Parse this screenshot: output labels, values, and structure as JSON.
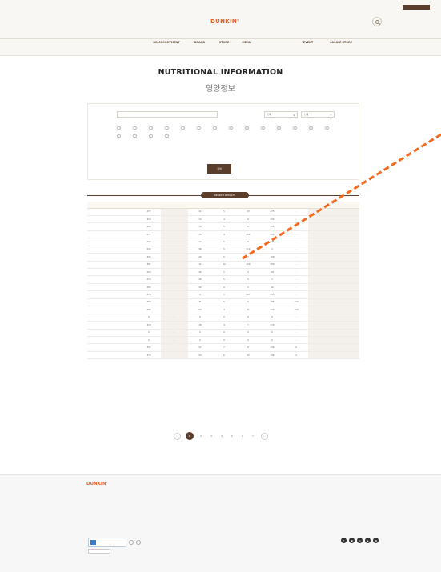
{
  "header": {
    "top_badge": "",
    "brand": "DUNKIN'",
    "left_links": [
      "",
      "",
      "",
      "",
      ""
    ],
    "right_links": [
      "",
      "",
      ""
    ],
    "sub_links": [
      "",
      ""
    ],
    "nav": [
      "DD COMMITMENT",
      "BRAND",
      "STORE",
      "MENU",
      "",
      "EVENT",
      "ONLINE STORE"
    ]
  },
  "page": {
    "title_en": "NUTRITIONAL INFORMATION",
    "title_ko": "영양정보"
  },
  "search": {
    "product_label": "",
    "product_placeholder": "",
    "category_label": "",
    "select1": "전체",
    "select2": "전체",
    "allergy_label": "",
    "checkboxes_row1": [
      "",
      "",
      "",
      "",
      "",
      "",
      "",
      "",
      "",
      "",
      "",
      "",
      "",
      ""
    ],
    "checkboxes_row2": [
      "",
      "",
      "",
      ""
    ],
    "notes": [
      "",
      ""
    ],
    "submit_label": "검색"
  },
  "results": {
    "count_text": "",
    "bar_label": "SEARCH RESULTS",
    "columns": [
      "",
      "",
      "",
      "",
      "",
      "",
      "",
      "",
      ""
    ],
    "rows": [
      [
        "",
        "277",
        "",
        "11",
        "5",
        "13",
        "275",
        "-",
        ""
      ],
      [
        "",
        "329",
        "",
        "14",
        "4",
        "8",
        "295",
        "-",
        ""
      ],
      [
        "",
        "466",
        "",
        "14",
        "5",
        "17",
        "345",
        "-",
        ""
      ],
      [
        "",
        "277",
        "",
        "13",
        "4",
        "252",
        "330",
        "-",
        ""
      ],
      [
        "",
        "222",
        "",
        "17",
        "5",
        "2",
        "275",
        "-",
        ""
      ],
      [
        "",
        "549",
        "",
        "38",
        "5",
        "514",
        "1",
        "-",
        ""
      ],
      [
        "",
        "398",
        "",
        "20",
        "6",
        "7",
        "168",
        "-",
        ""
      ],
      [
        "",
        "381",
        "",
        "11",
        "12",
        "229",
        "389",
        "-",
        ""
      ],
      [
        "",
        "223",
        "",
        "36",
        "5",
        "3",
        "187",
        "-",
        ""
      ],
      [
        "",
        "270",
        "",
        "48",
        "5",
        "5",
        "1",
        "-",
        ""
      ],
      [
        "",
        "285",
        "",
        "40",
        "0",
        "5",
        "16",
        "-",
        ""
      ],
      [
        "",
        "276",
        "",
        "9",
        "1",
        "227",
        "155",
        "-",
        ""
      ],
      [
        "",
        "360",
        "",
        "31",
        "5",
        "5",
        "388",
        "150",
        ""
      ],
      [
        "",
        "286",
        "",
        "53",
        "4",
        "21",
        "139",
        "150",
        ""
      ],
      [
        "",
        "0",
        "-",
        "0",
        "0",
        "0",
        "0",
        "-",
        ""
      ],
      [
        "",
        "328",
        "",
        "18",
        "4",
        "7",
        "370",
        "-",
        ""
      ],
      [
        "",
        "0",
        "-",
        "0",
        "0",
        "0",
        "0",
        "-",
        ""
      ],
      [
        "",
        "0",
        "-",
        "0",
        "0",
        "0",
        "0",
        "-",
        ""
      ],
      [
        "",
        "345",
        "",
        "27",
        "7",
        "8",
        "196",
        "2",
        ""
      ],
      [
        "",
        "376",
        "",
        "23",
        "6",
        "43",
        "108",
        "3",
        ""
      ]
    ]
  },
  "pagination": {
    "prev": "‹",
    "pages": [
      "1",
      "2",
      "3",
      "4",
      "5",
      "6",
      "7"
    ],
    "current": "1",
    "next": "›"
  },
  "footer": {
    "brand": "DUNKIN'",
    "info_lines": [
      "",
      "",
      "",
      ""
    ],
    "columns": [
      {
        "title": "",
        "items": [
          "",
          "",
          "",
          "",
          ""
        ]
      },
      {
        "title": "",
        "items": [
          "",
          "",
          ""
        ]
      },
      {
        "title": "",
        "items": [
          "",
          "",
          ""
        ]
      },
      {
        "title": "",
        "items": [
          "",
          "",
          ""
        ]
      }
    ],
    "right_links": [
      "",
      "",
      "",
      "",
      "",
      ""
    ],
    "social_icons": [
      "f",
      "▣",
      "◎",
      "▶",
      "▦"
    ],
    "badge_text": "",
    "family_select": "",
    "bottom_links": [
      "",
      "",
      "",
      "",
      "",
      "",
      "",
      ""
    ]
  },
  "colors": {
    "accent": "#e85f2a",
    "brown": "#5a3e2b",
    "header_bg": "#f9f7f3"
  }
}
